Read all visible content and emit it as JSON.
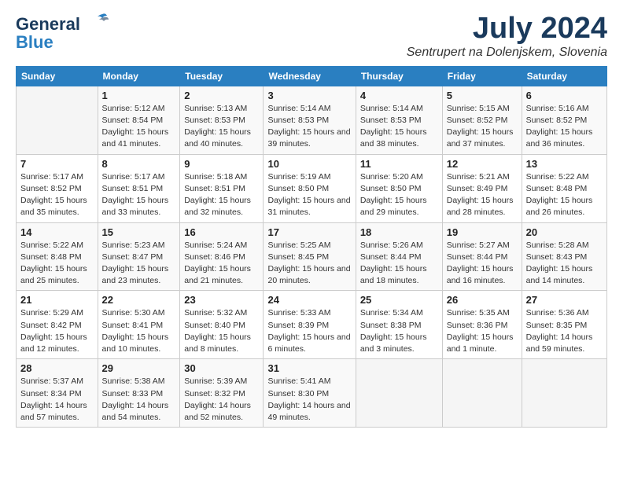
{
  "logo": {
    "general": "General",
    "blue": "Blue"
  },
  "title": {
    "month_year": "July 2024",
    "location": "Sentrupert na Dolenjskem, Slovenia"
  },
  "headers": [
    "Sunday",
    "Monday",
    "Tuesday",
    "Wednesday",
    "Thursday",
    "Friday",
    "Saturday"
  ],
  "weeks": [
    [
      {
        "day": "",
        "sunrise": "",
        "sunset": "",
        "daylight": ""
      },
      {
        "day": "1",
        "sunrise": "Sunrise: 5:12 AM",
        "sunset": "Sunset: 8:54 PM",
        "daylight": "Daylight: 15 hours and 41 minutes."
      },
      {
        "day": "2",
        "sunrise": "Sunrise: 5:13 AM",
        "sunset": "Sunset: 8:53 PM",
        "daylight": "Daylight: 15 hours and 40 minutes."
      },
      {
        "day": "3",
        "sunrise": "Sunrise: 5:14 AM",
        "sunset": "Sunset: 8:53 PM",
        "daylight": "Daylight: 15 hours and 39 minutes."
      },
      {
        "day": "4",
        "sunrise": "Sunrise: 5:14 AM",
        "sunset": "Sunset: 8:53 PM",
        "daylight": "Daylight: 15 hours and 38 minutes."
      },
      {
        "day": "5",
        "sunrise": "Sunrise: 5:15 AM",
        "sunset": "Sunset: 8:52 PM",
        "daylight": "Daylight: 15 hours and 37 minutes."
      },
      {
        "day": "6",
        "sunrise": "Sunrise: 5:16 AM",
        "sunset": "Sunset: 8:52 PM",
        "daylight": "Daylight: 15 hours and 36 minutes."
      }
    ],
    [
      {
        "day": "7",
        "sunrise": "Sunrise: 5:17 AM",
        "sunset": "Sunset: 8:52 PM",
        "daylight": "Daylight: 15 hours and 35 minutes."
      },
      {
        "day": "8",
        "sunrise": "Sunrise: 5:17 AM",
        "sunset": "Sunset: 8:51 PM",
        "daylight": "Daylight: 15 hours and 33 minutes."
      },
      {
        "day": "9",
        "sunrise": "Sunrise: 5:18 AM",
        "sunset": "Sunset: 8:51 PM",
        "daylight": "Daylight: 15 hours and 32 minutes."
      },
      {
        "day": "10",
        "sunrise": "Sunrise: 5:19 AM",
        "sunset": "Sunset: 8:50 PM",
        "daylight": "Daylight: 15 hours and 31 minutes."
      },
      {
        "day": "11",
        "sunrise": "Sunrise: 5:20 AM",
        "sunset": "Sunset: 8:50 PM",
        "daylight": "Daylight: 15 hours and 29 minutes."
      },
      {
        "day": "12",
        "sunrise": "Sunrise: 5:21 AM",
        "sunset": "Sunset: 8:49 PM",
        "daylight": "Daylight: 15 hours and 28 minutes."
      },
      {
        "day": "13",
        "sunrise": "Sunrise: 5:22 AM",
        "sunset": "Sunset: 8:48 PM",
        "daylight": "Daylight: 15 hours and 26 minutes."
      }
    ],
    [
      {
        "day": "14",
        "sunrise": "Sunrise: 5:22 AM",
        "sunset": "Sunset: 8:48 PM",
        "daylight": "Daylight: 15 hours and 25 minutes."
      },
      {
        "day": "15",
        "sunrise": "Sunrise: 5:23 AM",
        "sunset": "Sunset: 8:47 PM",
        "daylight": "Daylight: 15 hours and 23 minutes."
      },
      {
        "day": "16",
        "sunrise": "Sunrise: 5:24 AM",
        "sunset": "Sunset: 8:46 PM",
        "daylight": "Daylight: 15 hours and 21 minutes."
      },
      {
        "day": "17",
        "sunrise": "Sunrise: 5:25 AM",
        "sunset": "Sunset: 8:45 PM",
        "daylight": "Daylight: 15 hours and 20 minutes."
      },
      {
        "day": "18",
        "sunrise": "Sunrise: 5:26 AM",
        "sunset": "Sunset: 8:44 PM",
        "daylight": "Daylight: 15 hours and 18 minutes."
      },
      {
        "day": "19",
        "sunrise": "Sunrise: 5:27 AM",
        "sunset": "Sunset: 8:44 PM",
        "daylight": "Daylight: 15 hours and 16 minutes."
      },
      {
        "day": "20",
        "sunrise": "Sunrise: 5:28 AM",
        "sunset": "Sunset: 8:43 PM",
        "daylight": "Daylight: 15 hours and 14 minutes."
      }
    ],
    [
      {
        "day": "21",
        "sunrise": "Sunrise: 5:29 AM",
        "sunset": "Sunset: 8:42 PM",
        "daylight": "Daylight: 15 hours and 12 minutes."
      },
      {
        "day": "22",
        "sunrise": "Sunrise: 5:30 AM",
        "sunset": "Sunset: 8:41 PM",
        "daylight": "Daylight: 15 hours and 10 minutes."
      },
      {
        "day": "23",
        "sunrise": "Sunrise: 5:32 AM",
        "sunset": "Sunset: 8:40 PM",
        "daylight": "Daylight: 15 hours and 8 minutes."
      },
      {
        "day": "24",
        "sunrise": "Sunrise: 5:33 AM",
        "sunset": "Sunset: 8:39 PM",
        "daylight": "Daylight: 15 hours and 6 minutes."
      },
      {
        "day": "25",
        "sunrise": "Sunrise: 5:34 AM",
        "sunset": "Sunset: 8:38 PM",
        "daylight": "Daylight: 15 hours and 3 minutes."
      },
      {
        "day": "26",
        "sunrise": "Sunrise: 5:35 AM",
        "sunset": "Sunset: 8:36 PM",
        "daylight": "Daylight: 15 hours and 1 minute."
      },
      {
        "day": "27",
        "sunrise": "Sunrise: 5:36 AM",
        "sunset": "Sunset: 8:35 PM",
        "daylight": "Daylight: 14 hours and 59 minutes."
      }
    ],
    [
      {
        "day": "28",
        "sunrise": "Sunrise: 5:37 AM",
        "sunset": "Sunset: 8:34 PM",
        "daylight": "Daylight: 14 hours and 57 minutes."
      },
      {
        "day": "29",
        "sunrise": "Sunrise: 5:38 AM",
        "sunset": "Sunset: 8:33 PM",
        "daylight": "Daylight: 14 hours and 54 minutes."
      },
      {
        "day": "30",
        "sunrise": "Sunrise: 5:39 AM",
        "sunset": "Sunset: 8:32 PM",
        "daylight": "Daylight: 14 hours and 52 minutes."
      },
      {
        "day": "31",
        "sunrise": "Sunrise: 5:41 AM",
        "sunset": "Sunset: 8:30 PM",
        "daylight": "Daylight: 14 hours and 49 minutes."
      },
      {
        "day": "",
        "sunrise": "",
        "sunset": "",
        "daylight": ""
      },
      {
        "day": "",
        "sunrise": "",
        "sunset": "",
        "daylight": ""
      },
      {
        "day": "",
        "sunrise": "",
        "sunset": "",
        "daylight": ""
      }
    ]
  ]
}
